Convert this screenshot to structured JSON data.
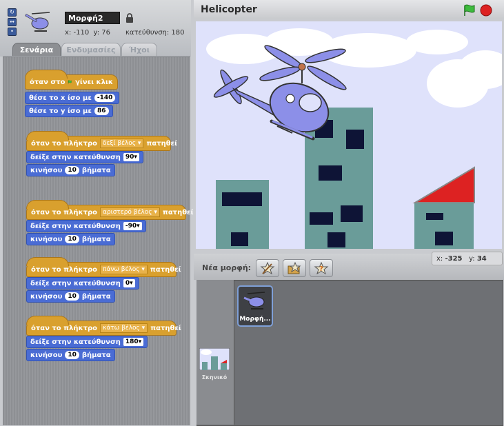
{
  "sprite": {
    "name": "Μορφή2",
    "x_label": "x:",
    "x": "-110",
    "y_label": "y:",
    "y": "76",
    "direction_label": "κατεύθυνση:",
    "direction": "180"
  },
  "tabs": [
    "Σενάρια",
    "Ενδυμασίες",
    "Ήχοι"
  ],
  "scripts": [
    {
      "hat": {
        "before": "όταν στο",
        "after": "γίνει κλικ"
      },
      "blocks": [
        {
          "text": "θέσε το x ίσο με",
          "value": "-140"
        },
        {
          "text": "θέσε το y ίσο με",
          "value": "86"
        }
      ]
    },
    {
      "hat": {
        "before": "όταν το πλήκτρο",
        "key": "δεξί βέλος",
        "after": "πατηθεί"
      },
      "blocks": [
        {
          "text": "δείξε στην κατεύθυνση",
          "value": "90"
        },
        {
          "text": "κινήσου",
          "value": "10",
          "after": "βήματα"
        }
      ]
    },
    {
      "hat": {
        "before": "όταν το πλήκτρο",
        "key": "αριστερό βέλος",
        "after": "πατηθεί"
      },
      "blocks": [
        {
          "text": "δείξε στην κατεύθυνση",
          "value": "-90"
        },
        {
          "text": "κινήσου",
          "value": "10",
          "after": "βήματα"
        }
      ]
    },
    {
      "hat": {
        "before": "όταν το πλήκτρο",
        "key": "πάνω βέλος",
        "after": "πατηθεί"
      },
      "blocks": [
        {
          "text": "δείξε στην κατεύθυνση",
          "value": "0"
        },
        {
          "text": "κινήσου",
          "value": "10",
          "after": "βήματα"
        }
      ]
    },
    {
      "hat": {
        "before": "όταν το πλήκτρο",
        "key": "κάτω βέλος",
        "after": "πατηθεί"
      },
      "blocks": [
        {
          "text": "δείξε στην κατεύθυνση",
          "value": "180"
        },
        {
          "text": "κινήσου",
          "value": "10",
          "after": "βήματα"
        }
      ]
    }
  ],
  "stage": {
    "title": "Helicopter",
    "mouse_x_label": "x:",
    "mouse_x": "-325",
    "mouse_y_label": "y:",
    "mouse_y": "34"
  },
  "sprites_pane": {
    "new_sprite_label": "Νέα μορφή:",
    "sprite_thumb_label": "Μορφή...",
    "stage_thumb_label": "Σκηνικό"
  },
  "icons": [
    "green-flag-icon",
    "stop-icon",
    "lock-icon",
    "paint-new-sprite-icon",
    "import-sprite-icon",
    "random-sprite-icon"
  ],
  "colors": {
    "events_block": "#d9a02e",
    "motion_block": "#4a6cd4",
    "stop_red": "#d22",
    "flag_green": "#3dbb3d"
  }
}
